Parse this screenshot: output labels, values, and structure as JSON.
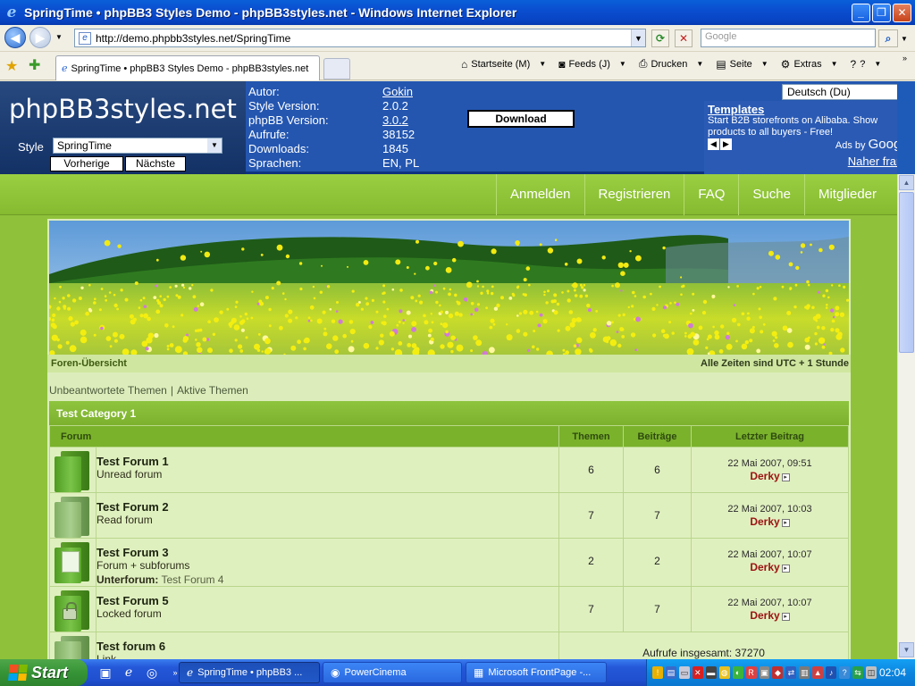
{
  "window": {
    "title": "SpringTime • phpBB3 Styles Demo - phpBB3styles.net - Windows Internet Explorer",
    "minimize": "_",
    "maximize": "❐",
    "close": "✕"
  },
  "browser": {
    "url": "http://demo.phpbb3styles.net/SpringTime",
    "search_placeholder": "Google",
    "tab_title": "SpringTime • phpBB3 Styles Demo - phpBB3styles.net",
    "commands": [
      {
        "icon": "home-icon",
        "glyph": "⌂",
        "label": "Startseite (M)"
      },
      {
        "icon": "feeds-icon",
        "glyph": "◙",
        "label": "Feeds (J)"
      },
      {
        "icon": "print-icon",
        "glyph": "⎙",
        "label": "Drucken"
      },
      {
        "icon": "page-icon",
        "glyph": "▤",
        "label": "Seite"
      },
      {
        "icon": "tools-icon",
        "glyph": "⚙",
        "label": "Extras"
      },
      {
        "icon": "help-icon",
        "glyph": "?",
        "label": "?"
      }
    ]
  },
  "demo_bar": {
    "logo": "phpBB3styles.net",
    "style_label": "Style",
    "style_value": "SpringTime",
    "prev_button": "Vorherige",
    "next_button": "Nächste",
    "info": [
      {
        "key": "Autor:",
        "value": "Gokin",
        "link": true
      },
      {
        "key": "Style Version:",
        "value": "2.0.2",
        "link": false
      },
      {
        "key": "phpBB Version:",
        "value": "3.0.2",
        "link": true
      },
      {
        "key": "Aufrufe:",
        "value": "38152",
        "link": false
      },
      {
        "key": "Downloads:",
        "value": "1845",
        "link": false
      },
      {
        "key": "Sprachen:",
        "value": "EN, PL",
        "link": false
      }
    ],
    "download_button": "Download",
    "language_value": "Deutsch (Du)",
    "ad": {
      "title": "Templates",
      "body": "Start B2B storefronts on Alibaba. Show products to all buyers - Free!",
      "ads_by": "Ads by",
      "google": "Google",
      "frame_link": "Naher frame"
    }
  },
  "forum": {
    "nav_links": [
      "Anmelden",
      "Registrieren",
      "FAQ",
      "Suche",
      "Mitglieder"
    ],
    "breadcrumb": "Foren-Übersicht",
    "timezone": "Alle Zeiten sind UTC + 1 Stunde",
    "quick_links": [
      "Unbeantwortete Themen",
      "Aktive Themen"
    ],
    "category": "Test Category 1",
    "columns": {
      "forum": "Forum",
      "topics": "Themen",
      "posts": "Beiträge",
      "last": "Letzter Beitrag"
    },
    "rows": [
      {
        "name": "Test Forum 1",
        "desc": "Unread forum",
        "topics": "6",
        "posts": "6",
        "date": "22 Mai 2007, 09:51",
        "user": "Derky",
        "icon": "unread"
      },
      {
        "name": "Test Forum 2",
        "desc": "Read forum",
        "topics": "7",
        "posts": "7",
        "date": "22 Mai 2007, 10:03",
        "user": "Derky",
        "icon": "read"
      },
      {
        "name": "Test Forum 3",
        "desc": "Forum + subforums",
        "subforums_label": "Unterforum:",
        "subforums": "Test Forum 4",
        "topics": "2",
        "posts": "2",
        "date": "22 Mai 2007, 10:07",
        "user": "Derky",
        "icon": "subforum"
      },
      {
        "name": "Test Forum 5",
        "desc": "Locked forum",
        "topics": "7",
        "posts": "7",
        "date": "22 Mai 2007, 10:07",
        "user": "Derky",
        "icon": "locked"
      },
      {
        "name": "Test forum 6",
        "desc": "Link",
        "redirect": "Aufrufe insgesamt: 37270",
        "icon": "link"
      }
    ]
  },
  "taskbar": {
    "start": "Start",
    "windows": [
      {
        "label": "SpringTime • phpBB3 ...",
        "active": true
      },
      {
        "label": "PowerCinema",
        "active": false
      },
      {
        "label": "Microsoft FrontPage -...",
        "active": false
      }
    ],
    "clock": "02:04"
  }
}
